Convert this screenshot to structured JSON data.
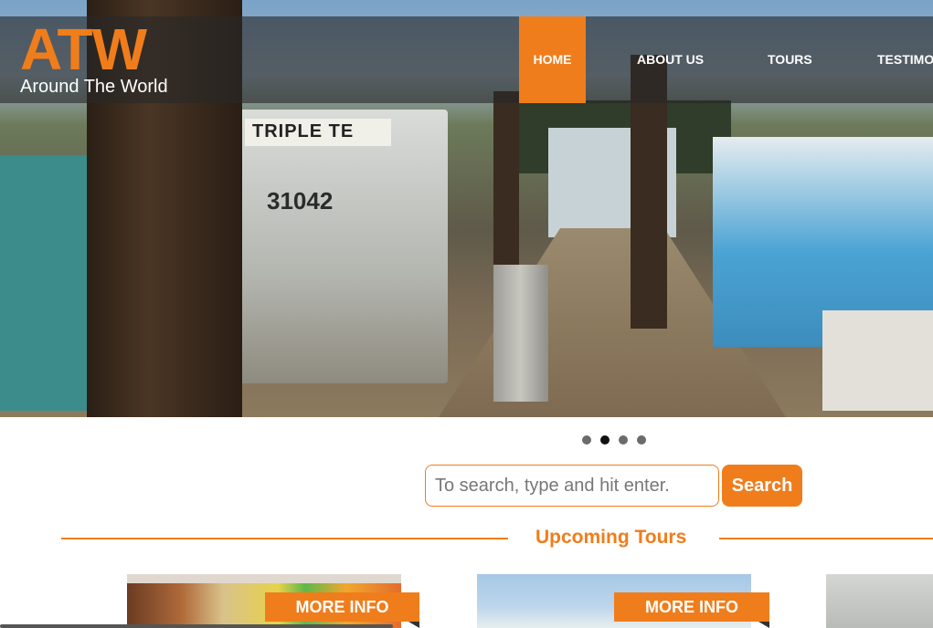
{
  "brand": {
    "mark": "ATW",
    "tagline": "Around The World",
    "accent_color": "#f07d1b"
  },
  "nav": {
    "items": [
      {
        "label": "HOME",
        "active": true
      },
      {
        "label": "ABOUT US",
        "active": false
      },
      {
        "label": "TOURS",
        "active": false
      },
      {
        "label": "TESTIMO",
        "active": false
      }
    ]
  },
  "hero": {
    "boat_sign": "TRIPLE TE",
    "boat_number": "31042",
    "slides": {
      "count": 4,
      "active_index": 1
    }
  },
  "search": {
    "placeholder": "To search, type and hit enter.",
    "value": "",
    "button_label": "Search"
  },
  "upcoming": {
    "title": "Upcoming Tours",
    "cards": [
      {
        "button_label": "MORE INFO"
      },
      {
        "button_label": "MORE INFO"
      },
      {
        "button_label": ""
      }
    ]
  }
}
